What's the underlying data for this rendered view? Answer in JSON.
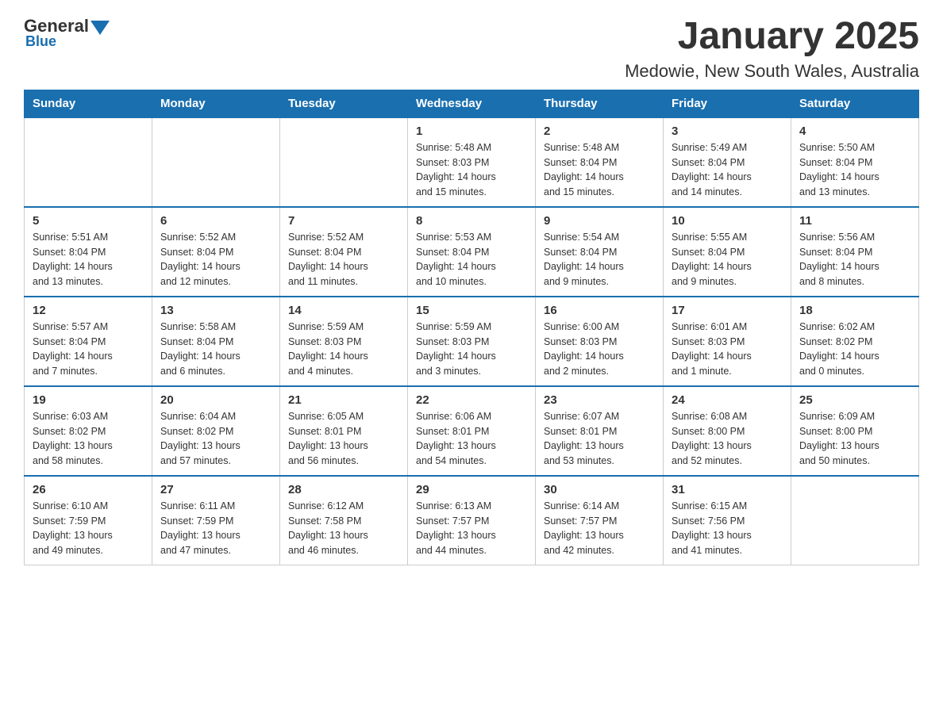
{
  "logo": {
    "name_part1": "General",
    "name_part2": "Blue"
  },
  "title": "January 2025",
  "subtitle": "Medowie, New South Wales, Australia",
  "days_of_week": [
    "Sunday",
    "Monday",
    "Tuesday",
    "Wednesday",
    "Thursday",
    "Friday",
    "Saturday"
  ],
  "weeks": [
    [
      {
        "day": "",
        "info": ""
      },
      {
        "day": "",
        "info": ""
      },
      {
        "day": "",
        "info": ""
      },
      {
        "day": "1",
        "info": "Sunrise: 5:48 AM\nSunset: 8:03 PM\nDaylight: 14 hours\nand 15 minutes."
      },
      {
        "day": "2",
        "info": "Sunrise: 5:48 AM\nSunset: 8:04 PM\nDaylight: 14 hours\nand 15 minutes."
      },
      {
        "day": "3",
        "info": "Sunrise: 5:49 AM\nSunset: 8:04 PM\nDaylight: 14 hours\nand 14 minutes."
      },
      {
        "day": "4",
        "info": "Sunrise: 5:50 AM\nSunset: 8:04 PM\nDaylight: 14 hours\nand 13 minutes."
      }
    ],
    [
      {
        "day": "5",
        "info": "Sunrise: 5:51 AM\nSunset: 8:04 PM\nDaylight: 14 hours\nand 13 minutes."
      },
      {
        "day": "6",
        "info": "Sunrise: 5:52 AM\nSunset: 8:04 PM\nDaylight: 14 hours\nand 12 minutes."
      },
      {
        "day": "7",
        "info": "Sunrise: 5:52 AM\nSunset: 8:04 PM\nDaylight: 14 hours\nand 11 minutes."
      },
      {
        "day": "8",
        "info": "Sunrise: 5:53 AM\nSunset: 8:04 PM\nDaylight: 14 hours\nand 10 minutes."
      },
      {
        "day": "9",
        "info": "Sunrise: 5:54 AM\nSunset: 8:04 PM\nDaylight: 14 hours\nand 9 minutes."
      },
      {
        "day": "10",
        "info": "Sunrise: 5:55 AM\nSunset: 8:04 PM\nDaylight: 14 hours\nand 9 minutes."
      },
      {
        "day": "11",
        "info": "Sunrise: 5:56 AM\nSunset: 8:04 PM\nDaylight: 14 hours\nand 8 minutes."
      }
    ],
    [
      {
        "day": "12",
        "info": "Sunrise: 5:57 AM\nSunset: 8:04 PM\nDaylight: 14 hours\nand 7 minutes."
      },
      {
        "day": "13",
        "info": "Sunrise: 5:58 AM\nSunset: 8:04 PM\nDaylight: 14 hours\nand 6 minutes."
      },
      {
        "day": "14",
        "info": "Sunrise: 5:59 AM\nSunset: 8:03 PM\nDaylight: 14 hours\nand 4 minutes."
      },
      {
        "day": "15",
        "info": "Sunrise: 5:59 AM\nSunset: 8:03 PM\nDaylight: 14 hours\nand 3 minutes."
      },
      {
        "day": "16",
        "info": "Sunrise: 6:00 AM\nSunset: 8:03 PM\nDaylight: 14 hours\nand 2 minutes."
      },
      {
        "day": "17",
        "info": "Sunrise: 6:01 AM\nSunset: 8:03 PM\nDaylight: 14 hours\nand 1 minute."
      },
      {
        "day": "18",
        "info": "Sunrise: 6:02 AM\nSunset: 8:02 PM\nDaylight: 14 hours\nand 0 minutes."
      }
    ],
    [
      {
        "day": "19",
        "info": "Sunrise: 6:03 AM\nSunset: 8:02 PM\nDaylight: 13 hours\nand 58 minutes."
      },
      {
        "day": "20",
        "info": "Sunrise: 6:04 AM\nSunset: 8:02 PM\nDaylight: 13 hours\nand 57 minutes."
      },
      {
        "day": "21",
        "info": "Sunrise: 6:05 AM\nSunset: 8:01 PM\nDaylight: 13 hours\nand 56 minutes."
      },
      {
        "day": "22",
        "info": "Sunrise: 6:06 AM\nSunset: 8:01 PM\nDaylight: 13 hours\nand 54 minutes."
      },
      {
        "day": "23",
        "info": "Sunrise: 6:07 AM\nSunset: 8:01 PM\nDaylight: 13 hours\nand 53 minutes."
      },
      {
        "day": "24",
        "info": "Sunrise: 6:08 AM\nSunset: 8:00 PM\nDaylight: 13 hours\nand 52 minutes."
      },
      {
        "day": "25",
        "info": "Sunrise: 6:09 AM\nSunset: 8:00 PM\nDaylight: 13 hours\nand 50 minutes."
      }
    ],
    [
      {
        "day": "26",
        "info": "Sunrise: 6:10 AM\nSunset: 7:59 PM\nDaylight: 13 hours\nand 49 minutes."
      },
      {
        "day": "27",
        "info": "Sunrise: 6:11 AM\nSunset: 7:59 PM\nDaylight: 13 hours\nand 47 minutes."
      },
      {
        "day": "28",
        "info": "Sunrise: 6:12 AM\nSunset: 7:58 PM\nDaylight: 13 hours\nand 46 minutes."
      },
      {
        "day": "29",
        "info": "Sunrise: 6:13 AM\nSunset: 7:57 PM\nDaylight: 13 hours\nand 44 minutes."
      },
      {
        "day": "30",
        "info": "Sunrise: 6:14 AM\nSunset: 7:57 PM\nDaylight: 13 hours\nand 42 minutes."
      },
      {
        "day": "31",
        "info": "Sunrise: 6:15 AM\nSunset: 7:56 PM\nDaylight: 13 hours\nand 41 minutes."
      },
      {
        "day": "",
        "info": ""
      }
    ]
  ]
}
